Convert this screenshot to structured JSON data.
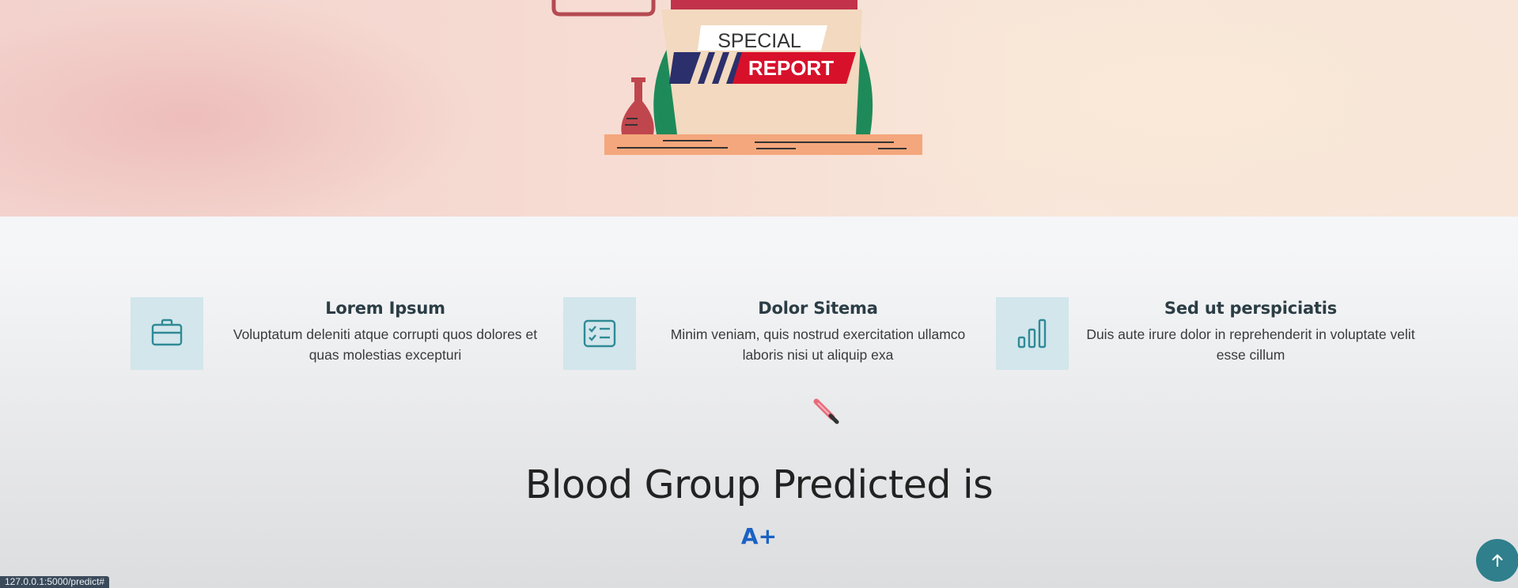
{
  "hero": {
    "badge_top": "SPECIAL",
    "badge_bottom": "REPORT"
  },
  "features": [
    {
      "icon": "briefcase-icon",
      "title": "Lorem Ipsum",
      "description": "Voluptatum deleniti atque corrupti quos dolores et quas molestias excepturi"
    },
    {
      "icon": "checklist-icon",
      "title": "Dolor Sitema",
      "description": "Minim veniam, quis nostrud exercitation ullamco laboris nisi ut aliquip exa"
    },
    {
      "icon": "bar-chart-icon",
      "title": "Sed ut perspiciatis",
      "description": "Duis aute irure dolor in reprehenderit in voluptate velit esse cillum"
    }
  ],
  "result": {
    "title": "Blood Group Predicted is",
    "value": "A+"
  },
  "status_bar": {
    "url": "127.0.0.1:5000/predict#"
  },
  "back_to_top": {
    "icon": "arrow-up-icon"
  },
  "colors": {
    "accent": "#1a62c4",
    "icon_box": "#d2e6ec",
    "icon_stroke": "#2f8a96",
    "back_to_top": "#2f7f8c",
    "report_red": "#d8112b",
    "report_navy": "#2b2f6b"
  }
}
